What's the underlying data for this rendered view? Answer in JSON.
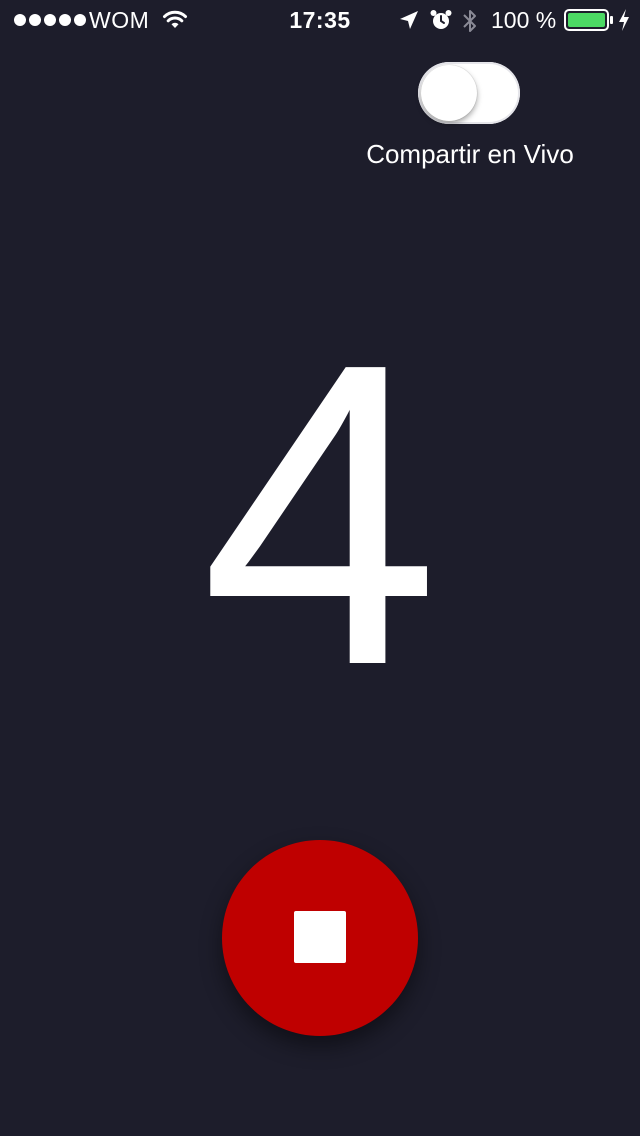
{
  "status_bar": {
    "signal_icon": "signal-dots-icon",
    "carrier": "WOM",
    "wifi_icon": "wifi-icon",
    "time": "17:35",
    "location_icon": "location-arrow-icon",
    "alarm_icon": "alarm-clock-icon",
    "bluetooth_icon": "bluetooth-icon",
    "battery_percent": "100 %",
    "battery_icon": "battery-icon",
    "battery_level": 1.0,
    "charging_icon": "lightning-bolt-icon",
    "battery_color": "#4cd964"
  },
  "live_share": {
    "label": "Compartir en Vivo",
    "enabled": false
  },
  "countdown": {
    "value": "4"
  },
  "stop_button": {
    "icon": "stop-square-icon",
    "color": "#bf0000"
  },
  "colors": {
    "background": "#1d1d2b",
    "text": "#ffffff"
  }
}
